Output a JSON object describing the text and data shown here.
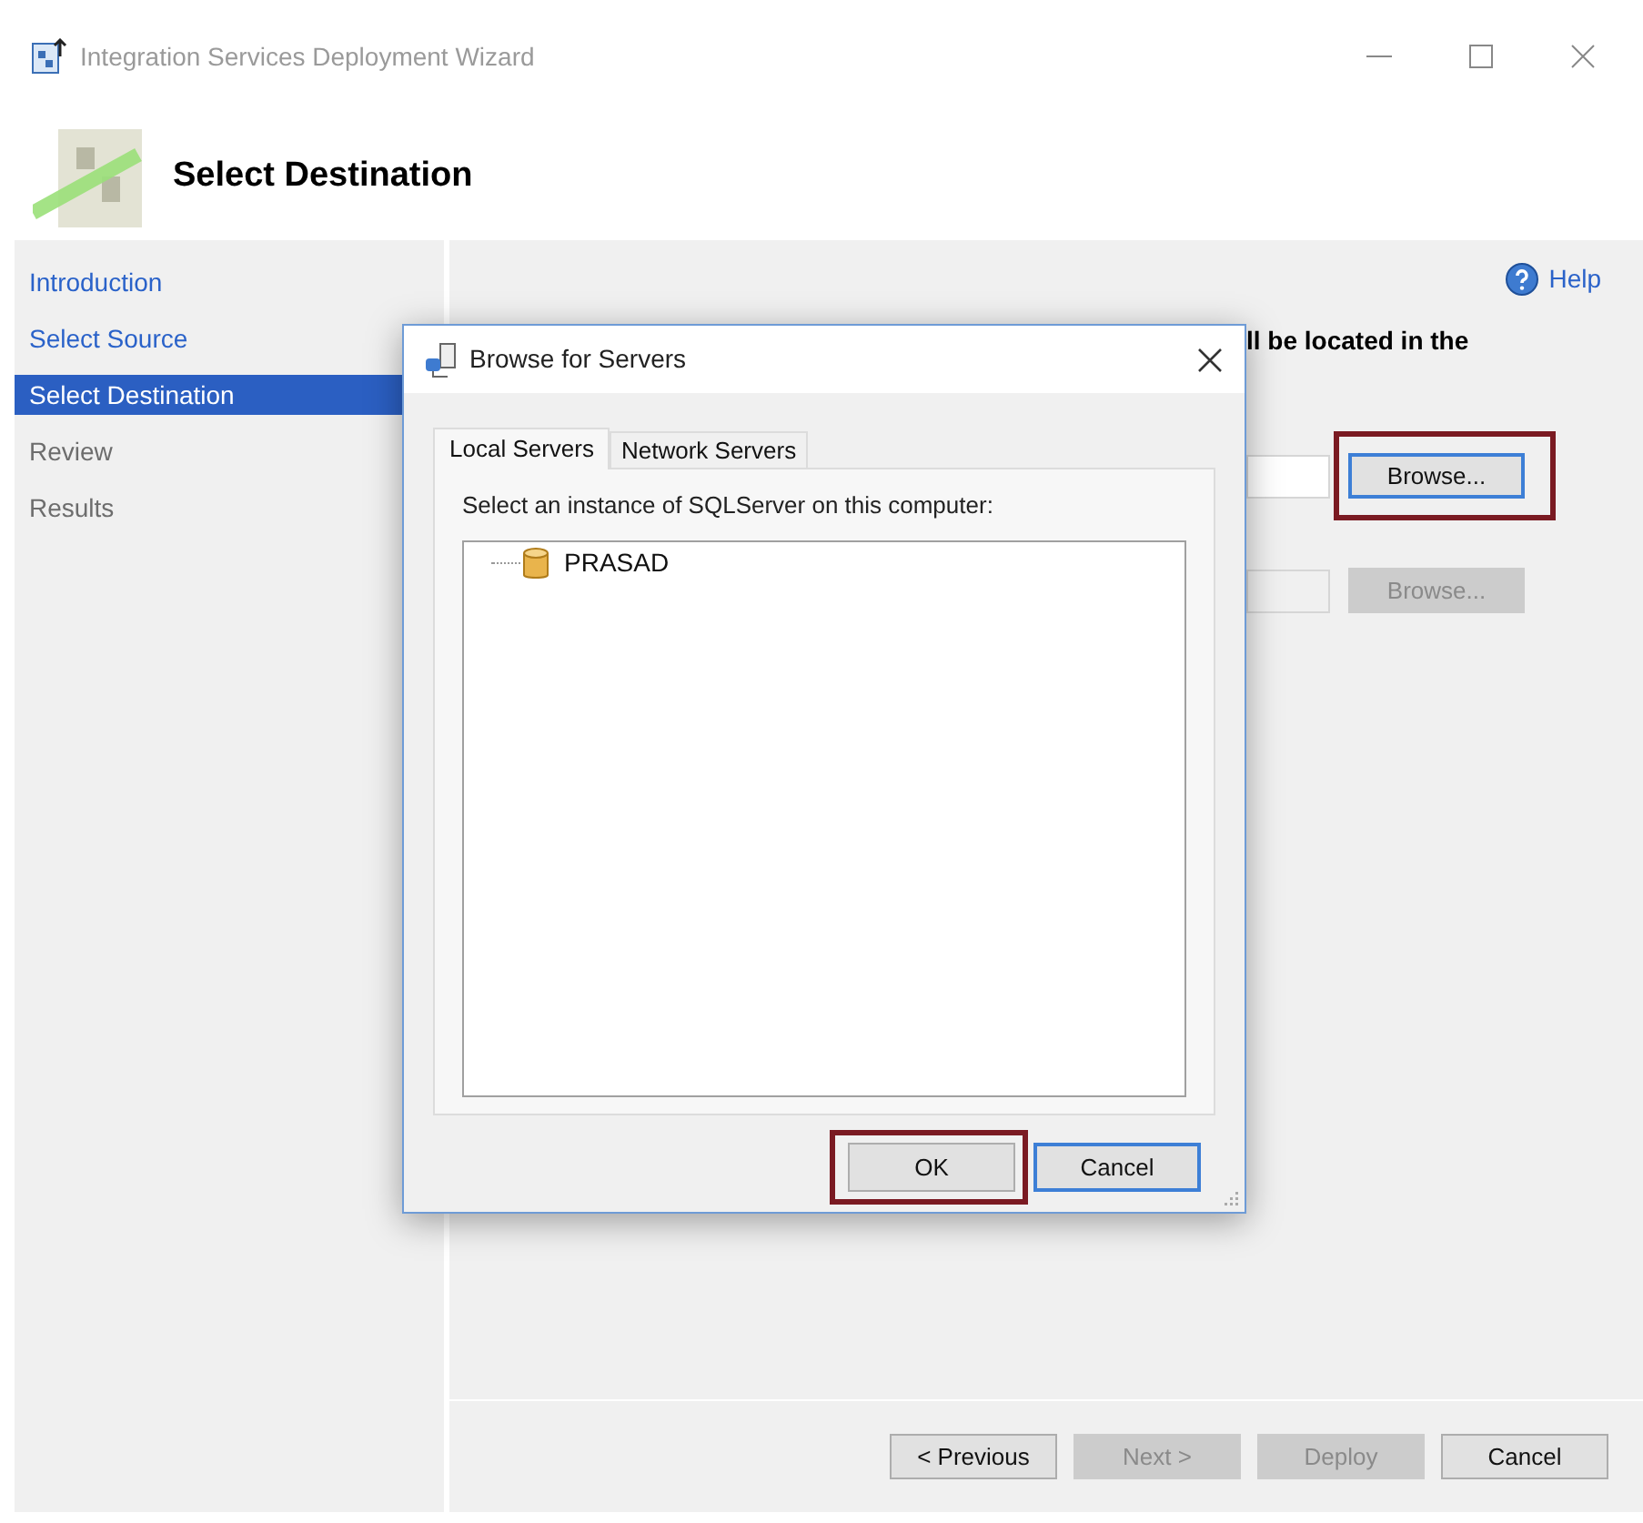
{
  "window": {
    "title": "Integration Services Deployment Wizard"
  },
  "header": {
    "title": "Select Destination"
  },
  "sidebar": {
    "items": [
      {
        "label": "Introduction",
        "selected": false,
        "visited": true
      },
      {
        "label": "Select Source",
        "selected": false,
        "visited": true
      },
      {
        "label": "Select Destination",
        "selected": true
      },
      {
        "label": "Review",
        "selected": false,
        "visited": false
      },
      {
        "label": "Results",
        "selected": false,
        "visited": false
      }
    ]
  },
  "help": {
    "label": "Help"
  },
  "content": {
    "description": "ll be located in the",
    "rows": [
      {
        "button": "Browse...",
        "disabled": false,
        "focused": true,
        "highlighted": true
      },
      {
        "button": "Browse...",
        "disabled": true,
        "focused": false,
        "highlighted": false
      }
    ]
  },
  "footer": {
    "buttons": [
      {
        "label": "< Previous",
        "disabled": false
      },
      {
        "label": "Next >",
        "disabled": true
      },
      {
        "label": "Deploy",
        "disabled": true
      },
      {
        "label": "Cancel",
        "disabled": false
      }
    ]
  },
  "dialog": {
    "title": "Browse for Servers",
    "tabs": [
      {
        "label": "Local Servers",
        "selected": true
      },
      {
        "label": "Network Servers",
        "selected": false
      }
    ],
    "prompt": "Select an instance of SQLServer on this computer:",
    "servers": [
      {
        "label": "PRASAD"
      }
    ],
    "buttons": [
      {
        "label": "OK",
        "focused": false,
        "highlighted": true
      },
      {
        "label": "Cancel",
        "focused": true,
        "highlighted": false
      }
    ]
  }
}
